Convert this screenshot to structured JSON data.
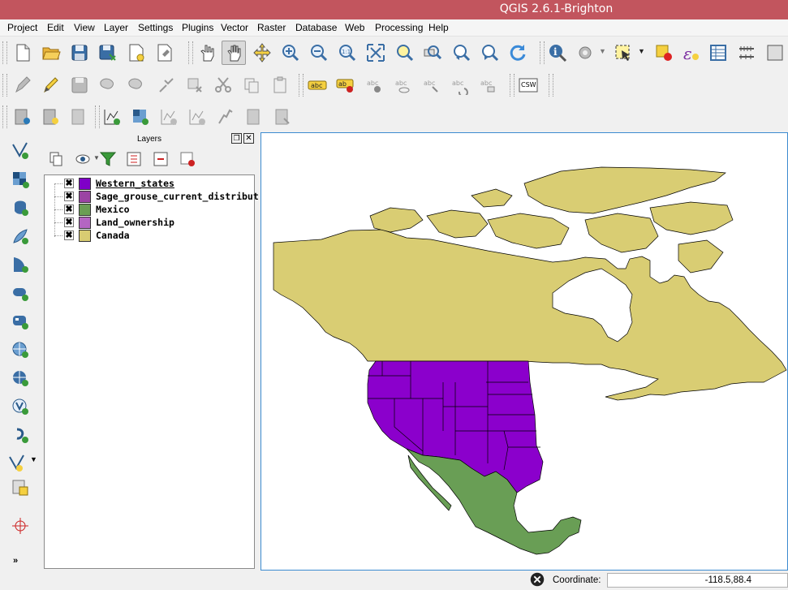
{
  "window": {
    "title": "QGIS 2.6.1-Brighton"
  },
  "menu": [
    "Project",
    "Edit",
    "View",
    "Layer",
    "Settings",
    "Plugins",
    "Vector",
    "Raster",
    "Database",
    "Web",
    "Processing",
    "Help"
  ],
  "toolbars": {
    "file": [
      "new-project-icon",
      "open-project-icon",
      "save-project-icon",
      "save-as-icon",
      "new-print-composer-icon",
      "composer-manager-icon"
    ],
    "navigation": [
      "touch-zoom-icon",
      "pan-icon",
      "pan-to-selection-icon",
      "zoom-in-icon",
      "zoom-out-icon",
      "zoom-actual-size-icon",
      "zoom-full-icon",
      "zoom-to-selection-icon",
      "zoom-to-layer-icon",
      "zoom-last-icon",
      "zoom-next-icon",
      "refresh-icon"
    ],
    "attributes": [
      "identify-icon",
      "action-icon",
      "select-feature-icon",
      "deselect-icon",
      "field-calculator-icon",
      "attribute-table-icon",
      "measure-icon"
    ],
    "editing": [
      "current-edits-icon",
      "toggle-editing-icon",
      "save-edits-icon",
      "add-feature-icon",
      "move-feature-icon",
      "node-tool-icon",
      "delete-selected-icon",
      "cut-features-icon",
      "copy-features-icon",
      "paste-features-icon"
    ],
    "labels": [
      "label-tool-icon",
      "layer-labeling-icon",
      "pin-label-icon",
      "show-hide-label-icon",
      "move-label-icon",
      "rotate-label-icon",
      "change-label-icon"
    ],
    "web": {
      "csw_label": "CSW"
    },
    "layer_creation": [
      "new-shapefile-icon",
      "new-spatialite-icon",
      "new-gpx-icon",
      "add-vector-icon",
      "add-raster-icon",
      "add-wms-icon",
      "add-wfs-icon",
      "add-delimited-icon",
      "add-postgis-icon",
      "add-oracle-icon"
    ]
  },
  "layers_panel": {
    "title": "Layers",
    "layers": [
      {
        "name": "Western_states",
        "color": "#7f00c8",
        "checked": "✖",
        "selected": true
      },
      {
        "name": "Sage_grouse_current_distribut...",
        "color": "#9b44a3",
        "checked": "✖"
      },
      {
        "name": "Mexico",
        "color": "#6a9e54",
        "checked": "✖"
      },
      {
        "name": "Land_ownership",
        "color": "#b465c2",
        "checked": "✖"
      },
      {
        "name": "Canada",
        "color": "#d8cc72",
        "checked": "✖"
      }
    ]
  },
  "map": {
    "colors": {
      "canada": "#d9cd73",
      "western_states": "#8b00cc",
      "mexico": "#699e55",
      "outline": "#000000"
    }
  },
  "statusbar": {
    "coordinate_label": "Coordinate:",
    "coordinate_value": "-118.5,88.4"
  }
}
